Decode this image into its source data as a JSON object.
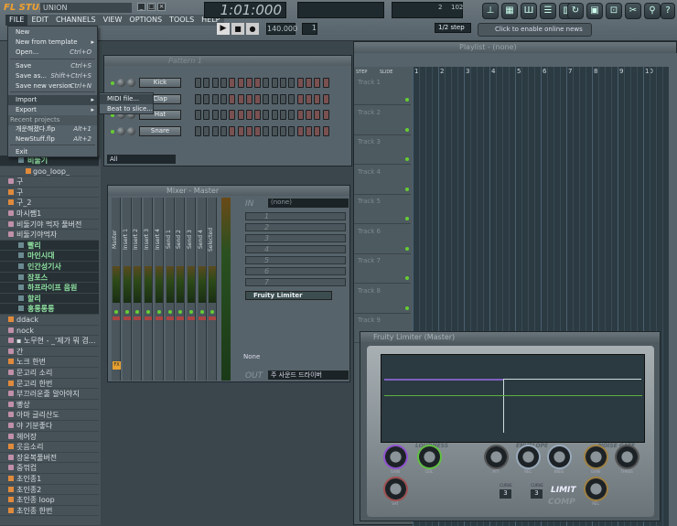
{
  "app": {
    "logo": "FL STUDIO",
    "song": "UNION"
  },
  "menubar": [
    "FILE",
    "EDIT",
    "CHANNELS",
    "VIEW",
    "OPTIONS",
    "TOOLS",
    "HELP"
  ],
  "transport": {
    "time": "1:01:000",
    "tempo": "140.000",
    "pattern": "1",
    "snap": "1/2 step",
    "news": "Click to enable online news",
    "cpu": "2",
    "poly": "102"
  },
  "file_menu": {
    "items": [
      {
        "label": "New",
        "shortcut": ""
      },
      {
        "label": "New from template",
        "shortcut": "",
        "submenu": true
      },
      {
        "label": "Open...",
        "shortcut": "Ctrl+O"
      },
      {
        "label": "Save",
        "shortcut": "Ctrl+S"
      },
      {
        "label": "Save as...",
        "shortcut": "Shift+Ctrl+S"
      },
      {
        "label": "Save new version",
        "shortcut": "Ctrl+N"
      },
      {
        "label": "Import",
        "shortcut": "",
        "submenu": true
      },
      {
        "label": "Export",
        "shortcut": "",
        "submenu": true
      },
      {
        "label": "Recent projects",
        "shortcut": ""
      },
      {
        "label": "개운해졌다.flp",
        "shortcut": "Alt+1"
      },
      {
        "label": "NewStuff.flp",
        "shortcut": "Alt+2"
      },
      {
        "label": "Exit",
        "shortcut": ""
      }
    ],
    "import_submenu": [
      "MIDI file...",
      "Beat to slice..."
    ]
  },
  "browser": {
    "items": [
      {
        "label": "비둘기",
        "type": "folder"
      },
      {
        "label": "goo_loop_",
        "type": "loop",
        "sub": true
      },
      {
        "label": "구",
        "type": "sample"
      },
      {
        "label": "구",
        "type": "loop"
      },
      {
        "label": "구_2",
        "type": "loop"
      },
      {
        "label": "마시쨈1",
        "type": "sample"
      },
      {
        "label": "비둘기야 먹자 풀버전",
        "type": "sample"
      },
      {
        "label": "비둘기야먹자",
        "type": "sample"
      },
      {
        "label": "빨리",
        "type": "folder"
      },
      {
        "label": "마인시대",
        "type": "folder"
      },
      {
        "label": "인간성기사",
        "type": "folder"
      },
      {
        "label": "잠포스",
        "type": "folder"
      },
      {
        "label": "하프라이프 음원",
        "type": "folder"
      },
      {
        "label": "할리",
        "type": "folder"
      },
      {
        "label": "홍롱롱롱",
        "type": "folder"
      },
      {
        "label": "ddack",
        "type": "loop"
      },
      {
        "label": "nock",
        "type": "sample"
      },
      {
        "label": "▪ 노무현 - _'제가 뭐 겸...",
        "type": "sample"
      },
      {
        "label": "간",
        "type": "sample"
      },
      {
        "label": "노크 한번",
        "type": "loop"
      },
      {
        "label": "문고리 소리",
        "type": "sample"
      },
      {
        "label": "문고리 한번",
        "type": "loop"
      },
      {
        "label": "부끄러운줄 알아야지",
        "type": "sample"
      },
      {
        "label": "빵상",
        "type": "sample"
      },
      {
        "label": "아마 글리산도",
        "type": "sample"
      },
      {
        "label": "야 기분좋다",
        "type": "sample"
      },
      {
        "label": "헤어장",
        "type": "sample"
      },
      {
        "label": "웃음소리",
        "type": "loop"
      },
      {
        "label": "장윤복풀버전",
        "type": "sample"
      },
      {
        "label": "중꺾컵",
        "type": "sample"
      },
      {
        "label": "초인종1",
        "type": "loop"
      },
      {
        "label": "초인종2",
        "type": "loop"
      },
      {
        "label": "초인종 loop",
        "type": "loop"
      },
      {
        "label": "초인종 한번",
        "type": "loop"
      }
    ]
  },
  "channel_rack": {
    "title": "Pattern 1",
    "filter": "All",
    "channels": [
      {
        "name": "Kick",
        "steps": [
          0,
          0,
          0,
          0,
          1,
          1,
          1,
          1,
          0,
          0,
          0,
          0,
          1,
          1,
          1,
          1
        ]
      },
      {
        "name": "Clap",
        "steps": [
          0,
          0,
          0,
          0,
          1,
          1,
          1,
          1,
          0,
          0,
          0,
          0,
          1,
          1,
          1,
          1
        ]
      },
      {
        "name": "Hat",
        "steps": [
          0,
          0,
          0,
          0,
          1,
          1,
          1,
          1,
          0,
          0,
          0,
          0,
          1,
          1,
          1,
          1
        ]
      },
      {
        "name": "Snare",
        "steps": [
          0,
          0,
          0,
          0,
          1,
          1,
          1,
          1,
          0,
          0,
          0,
          0,
          1,
          1,
          1,
          1
        ]
      }
    ]
  },
  "mixer": {
    "title": "Mixer - Master",
    "strips": [
      "Master",
      "Insert 1",
      "Insert 2",
      "Insert 3",
      "Insert 4",
      "Send 1",
      "Send 2",
      "Send 3",
      "Send 4",
      "Selected"
    ],
    "in": "(none)",
    "slots": [
      "1",
      "2",
      "3",
      "4",
      "5",
      "6",
      "7"
    ],
    "fx": "Fruity Limiter",
    "out": "주 사운드 드라이버",
    "eq_preset": "None",
    "fx_label": "FX"
  },
  "playlist": {
    "title": "Playlist - (none)",
    "step": "STEP",
    "slide": "SLIDE",
    "bars": [
      "1",
      "2",
      "3",
      "4",
      "5",
      "6",
      "7",
      "8",
      "9",
      "10"
    ],
    "tracks": [
      "Track 1",
      "Track 2",
      "Track 3",
      "Track 4",
      "Track 5",
      "Track 6",
      "Track 7",
      "Track 8",
      "Track 9"
    ]
  },
  "limiter": {
    "title": "Fruity Limiter (Master)",
    "sections": [
      "LOUDNESS",
      "ENVELOPE",
      "NOISE GATE"
    ],
    "knobs": [
      "GAIN",
      "SAT",
      "CEIL",
      "ATT",
      "REL",
      "KNEE",
      "GAIN",
      "THRES",
      "REL"
    ],
    "curve_label": "CURVE",
    "curve1": "3",
    "curve2": "3",
    "limit": "LIMIT",
    "comp": "COMP"
  },
  "colors": {
    "accent": "#f0a030",
    "step_on": "#7a5050",
    "step_off": "#4a5458",
    "gain": "#9050d0",
    "ceil": "#60c040"
  }
}
